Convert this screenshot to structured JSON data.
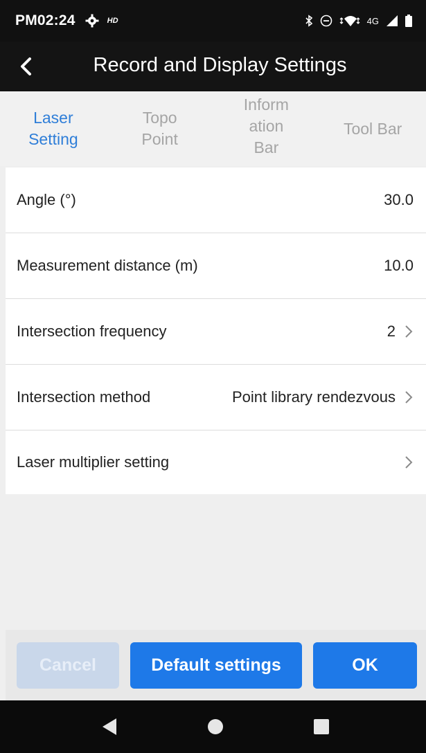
{
  "status": {
    "time": "PM02:24",
    "hd": "HD",
    "network": "4G"
  },
  "header": {
    "title": "Record and Display Settings"
  },
  "tabs": [
    {
      "label": "Laser\nSetting"
    },
    {
      "label": "Topo\nPoint"
    },
    {
      "label": "Inform\nation\nBar"
    },
    {
      "label": "Tool Bar"
    }
  ],
  "rows": [
    {
      "label": "Angle (°)",
      "value": "30.0"
    },
    {
      "label": "Measurement distance (m)",
      "value": "10.0"
    },
    {
      "label": "Intersection frequency",
      "value": "2"
    },
    {
      "label": "Intersection method",
      "value": "Point library rendezvous"
    },
    {
      "label": "Laser multiplier setting",
      "value": ""
    }
  ],
  "buttons": {
    "cancel": "Cancel",
    "default": "Default settings",
    "ok": "OK"
  },
  "colors": {
    "accent": "#1e79e8",
    "active_tab": "#2f7ed8",
    "header_bg": "#141414"
  }
}
